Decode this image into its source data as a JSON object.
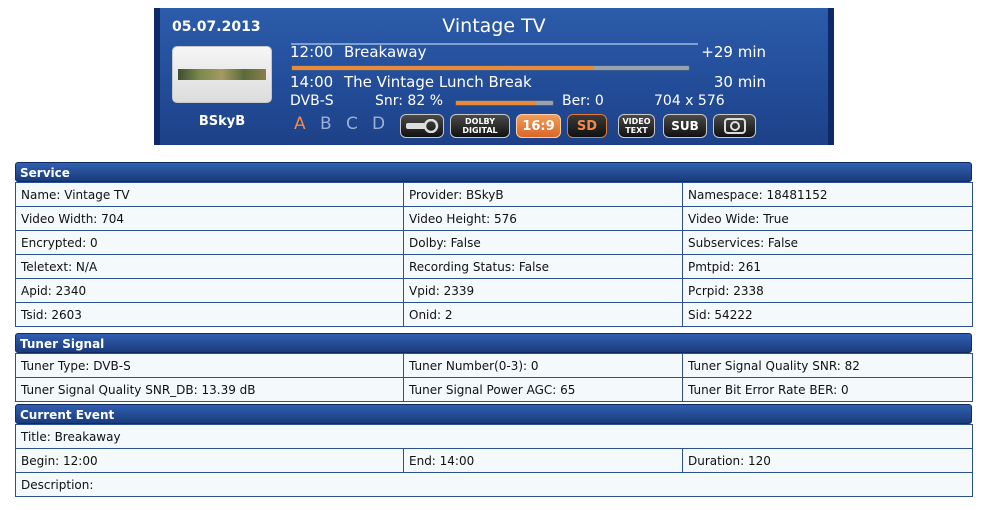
{
  "infobar": {
    "date": "05.07.2013",
    "channel": "Vintage TV",
    "provider": "BSkyB",
    "now": {
      "time": "12:00",
      "title": "Breakaway",
      "remaining": "+29 min",
      "progress": 0.76
    },
    "next": {
      "time": "14:00",
      "title": "The Vintage Lunch Break",
      "duration": "30 min"
    },
    "tuner_type": "DVB-S",
    "snr_label": "Snr: 82 %",
    "snr_value": 0.82,
    "ber_label": "Ber: 0",
    "resolution": "704 x 576",
    "audio_tracks": [
      "A",
      "B",
      "C",
      "D"
    ],
    "active_track": "A",
    "badges": {
      "dolby_top": "DOLBY",
      "dolby_bottom": "DIGITAL",
      "aspect": "16:9",
      "sd": "SD",
      "videotext_top": "VIDEO",
      "videotext_bottom": "TEXT",
      "sub": "SUB"
    },
    "colors": {
      "accent": "#e88a3c",
      "panel": "#234d99"
    }
  },
  "service": {
    "header": "Service",
    "rows": [
      [
        "Name: Vintage TV",
        "Provider: BSkyB",
        "Namespace: 18481152"
      ],
      [
        "Video Width: 704",
        "Video Height: 576",
        "Video Wide: True"
      ],
      [
        "Encrypted: 0",
        "Dolby: False",
        "Subservices: False"
      ],
      [
        "Teletext: N/A",
        "Recording Status: False",
        "Pmtpid: 261"
      ],
      [
        "Apid: 2340",
        "Vpid: 2339",
        "Pcrpid: 2338"
      ],
      [
        "Tsid: 2603",
        "Onid: 2",
        "Sid: 54222"
      ]
    ]
  },
  "tuner": {
    "header": "Tuner Signal",
    "rows": [
      [
        "Tuner Type: DVB-S",
        "Tuner Number(0-3): 0",
        "Tuner Signal Quality SNR: 82"
      ],
      [
        "Tuner Signal Quality SNR_DB: 13.39 dB",
        "Tuner Signal Power AGC: 65",
        "Tuner Bit Error Rate BER: 0"
      ]
    ]
  },
  "event": {
    "header": "Current Event",
    "title": "Title: Breakaway",
    "begin": "Begin: 12:00",
    "end": "End: 14:00",
    "duration": "Duration: 120",
    "description": "Description:"
  }
}
